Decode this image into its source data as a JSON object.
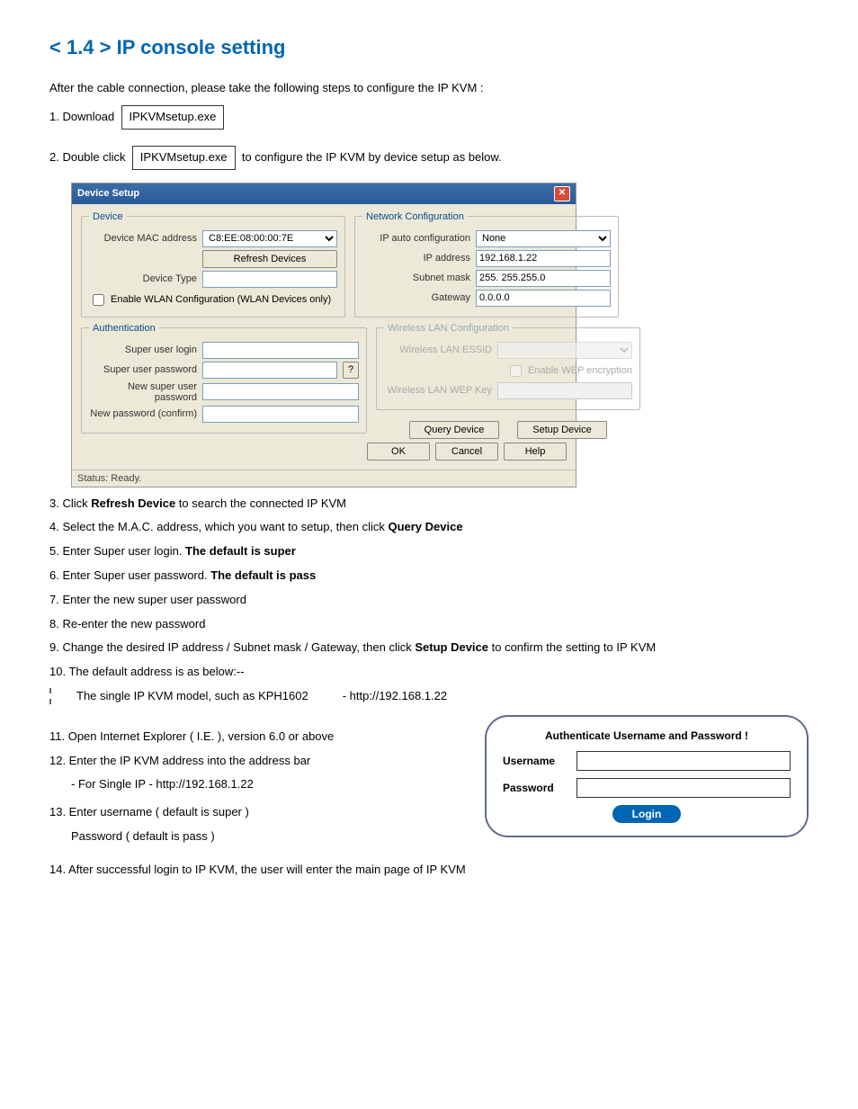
{
  "heading": "< 1.4 > IP console setting",
  "intro": "After the cable connection, please take the following steps to configure the IP KVM :",
  "step1_prefix": "1.  Download",
  "step1_file": "IPKVMsetup.exe",
  "step2_prefix": "2.  Double click",
  "step2_file": "IPKVMsetup.exe",
  "step2_suffix": "to configure the IP KVM by device setup as below.",
  "dialog": {
    "title": "Device Setup",
    "device_legend": "Device",
    "mac_label": "Device MAC address",
    "mac_value": "C8:EE:08:00:00:7E",
    "refresh_btn": "Refresh Devices",
    "type_label": "Device Type",
    "type_value": "",
    "wlan_checkbox": "Enable WLAN Configuration (WLAN Devices only)",
    "net_legend": "Network Configuration",
    "ipauto_label": "IP auto configuration",
    "ipauto_value": "None",
    "ipaddr_label": "IP address",
    "ipaddr_value": "192.168.1.22",
    "subnet_label": "Subnet mask",
    "subnet_value": "255. 255.255.0",
    "gateway_label": "Gateway",
    "gateway_value": "0.0.0.0",
    "auth_legend": "Authentication",
    "su_login_label": "Super user login",
    "su_pass_label": "Super user password",
    "new_pass_label": "New super user password",
    "new_pass2_label": "New password (confirm)",
    "q_btn": "?",
    "wlan_legend": "Wireless LAN Configuration",
    "essid_label": "Wireless LAN ESSID",
    "wep_checkbox": "Enable WEP encryption",
    "wepkey_label": "Wireless LAN WEP Key",
    "query_btn": "Query Device",
    "setup_btn": "Setup Device",
    "ok_btn": "OK",
    "cancel_btn": "Cancel",
    "help_btn": "Help",
    "status": "Status: Ready."
  },
  "step3_a": "3.  Click ",
  "step3_b": "Refresh Device",
  "step3_c": " to search the connected IP KVM",
  "step4_a": "4.  Select the M.A.C. address, which you want to setup, then click ",
  "step4_b": "Query Device",
  "step5_a": "5.  Enter Super user login.  ",
  "step5_b": "The default is super",
  "step6_a": "6.  Enter Super user password.  ",
  "step6_b": "The default is pass",
  "step7": "7.  Enter the new super user password",
  "step8": "8.  Re-enter the new password",
  "step9_a": "9.  Change the desired IP address / Subnet mask / Gateway, then click ",
  "step9_b": "Setup Device",
  "step9_c": " to confirm the setting to IP KVM",
  "step10": "10. The default address is as below:--",
  "step10_model": "The single IP KVM model, such as KPH1602",
  "step10_url": "- http://192.168.1.22",
  "step11": "11. Open Internet Explorer ( I.E. ), version 6.0 or above",
  "step12": "12. Enter the IP KVM address into the address bar",
  "step12b": "- For Single IP - http://192.168.1.22",
  "step13": "13. Enter username ( default is super )",
  "step13b": "Password ( default is pass )",
  "step14": "14. After successful login to IP KVM, the user will enter the main page of IP KVM",
  "auth_panel": {
    "title": "Authenticate Username and Password !",
    "username_label": "Username",
    "password_label": "Password",
    "login_btn": "Login"
  }
}
